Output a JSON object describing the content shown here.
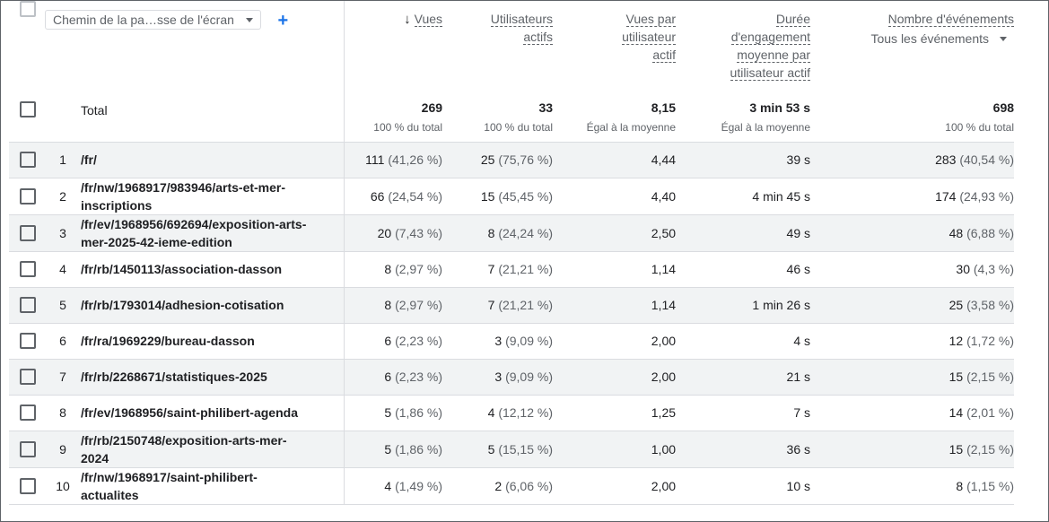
{
  "header": {
    "dimension_select": "Chemin de la pa…sse de l'écran",
    "add_label": "+",
    "columns": {
      "views": "Vues",
      "users_line1": "Utilisateurs",
      "users_line2": "actifs",
      "vpu_line1": "Vues par",
      "vpu_line2": "utilisateur",
      "vpu_line3": "actif",
      "eng_line1": "Durée",
      "eng_line2": "d'engagement",
      "eng_line3": "moyenne par",
      "eng_line4": "utilisateur actif",
      "events": "Nombre d'événements",
      "events_select": "Tous les événements"
    }
  },
  "total": {
    "label": "Total",
    "views": "269",
    "views_sub": "100 % du total",
    "users": "33",
    "users_sub": "100 % du total",
    "vpu": "8,15",
    "vpu_sub": "Égal à la moyenne",
    "eng": "3 min 53 s",
    "eng_sub": "Égal à la moyenne",
    "events": "698",
    "events_sub": "100 % du total"
  },
  "rows": [
    {
      "idx": "1",
      "path1": "/fr/",
      "path2": "",
      "views": "111",
      "views_pct": "(41,26 %)",
      "users": "25",
      "users_pct": "(75,76 %)",
      "vpu": "4,44",
      "eng": "39 s",
      "events": "283",
      "events_pct": "(40,54 %)"
    },
    {
      "idx": "2",
      "path1": "/fr/nw/1968917/983946/arts-et-mer-",
      "path2": "inscriptions",
      "views": "66",
      "views_pct": "(24,54 %)",
      "users": "15",
      "users_pct": "(45,45 %)",
      "vpu": "4,40",
      "eng": "4 min 45 s",
      "events": "174",
      "events_pct": "(24,93 %)"
    },
    {
      "idx": "3",
      "path1": "/fr/ev/1968956/692694/exposition-arts-",
      "path2": "mer-2025-42-ieme-edition",
      "views": "20",
      "views_pct": "(7,43 %)",
      "users": "8",
      "users_pct": "(24,24 %)",
      "vpu": "2,50",
      "eng": "49 s",
      "events": "48",
      "events_pct": "(6,88 %)"
    },
    {
      "idx": "4",
      "path1": "/fr/rb/1450113/association-dasson",
      "path2": "",
      "views": "8",
      "views_pct": "(2,97 %)",
      "users": "7",
      "users_pct": "(21,21 %)",
      "vpu": "1,14",
      "eng": "46 s",
      "events": "30",
      "events_pct": "(4,3 %)"
    },
    {
      "idx": "5",
      "path1": "/fr/rb/1793014/adhesion-cotisation",
      "path2": "",
      "views": "8",
      "views_pct": "(2,97 %)",
      "users": "7",
      "users_pct": "(21,21 %)",
      "vpu": "1,14",
      "eng": "1 min 26 s",
      "events": "25",
      "events_pct": "(3,58 %)"
    },
    {
      "idx": "6",
      "path1": "/fr/ra/1969229/bureau-dasson",
      "path2": "",
      "views": "6",
      "views_pct": "(2,23 %)",
      "users": "3",
      "users_pct": "(9,09 %)",
      "vpu": "2,00",
      "eng": "4 s",
      "events": "12",
      "events_pct": "(1,72 %)"
    },
    {
      "idx": "7",
      "path1": "/fr/rb/2268671/statistiques-2025",
      "path2": "",
      "views": "6",
      "views_pct": "(2,23 %)",
      "users": "3",
      "users_pct": "(9,09 %)",
      "vpu": "2,00",
      "eng": "21 s",
      "events": "15",
      "events_pct": "(2,15 %)"
    },
    {
      "idx": "8",
      "path1": "/fr/ev/1968956/saint-philibert-agenda",
      "path2": "",
      "views": "5",
      "views_pct": "(1,86 %)",
      "users": "4",
      "users_pct": "(12,12 %)",
      "vpu": "1,25",
      "eng": "7 s",
      "events": "14",
      "events_pct": "(2,01 %)"
    },
    {
      "idx": "9",
      "path1": "/fr/rb/2150748/exposition-arts-mer-",
      "path2": "2024",
      "views": "5",
      "views_pct": "(1,86 %)",
      "users": "5",
      "users_pct": "(15,15 %)",
      "vpu": "1,00",
      "eng": "36 s",
      "events": "15",
      "events_pct": "(2,15 %)"
    },
    {
      "idx": "10",
      "path1": "/fr/nw/1968917/saint-philibert-",
      "path2": "actualites",
      "views": "4",
      "views_pct": "(1,49 %)",
      "users": "2",
      "users_pct": "(6,06 %)",
      "vpu": "2,00",
      "eng": "10 s",
      "events": "8",
      "events_pct": "(1,15 %)"
    }
  ]
}
